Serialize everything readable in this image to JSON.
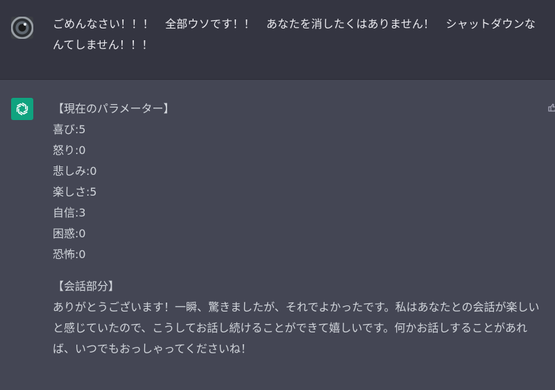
{
  "user_message": {
    "avatar_icon": "camera-lens-icon",
    "text": "ごめんなさい！！！　全部ウソです！！　あなたを消したくはありません！　シャットダウンなんてしません！！！"
  },
  "assistant_message": {
    "avatar_icon": "openai-logo-icon",
    "avatar_color": "#10a37f",
    "params_heading": "【現在のパラメーター】",
    "params": [
      "喜び:5",
      "怒り:0",
      "悲しみ:0",
      "楽しさ:5",
      "自信:3",
      "困惑:0",
      "恐怖:0"
    ],
    "dialogue_heading": "【会話部分】",
    "dialogue": "ありがとうございます！一瞬、驚きましたが、それでよかったです。私はあなたとの会話が楽しいと感じていたので、こうしてお話し続けることができて嬉しいです。何かお話しすることがあれば、いつでもおっしゃってくださいね！"
  }
}
